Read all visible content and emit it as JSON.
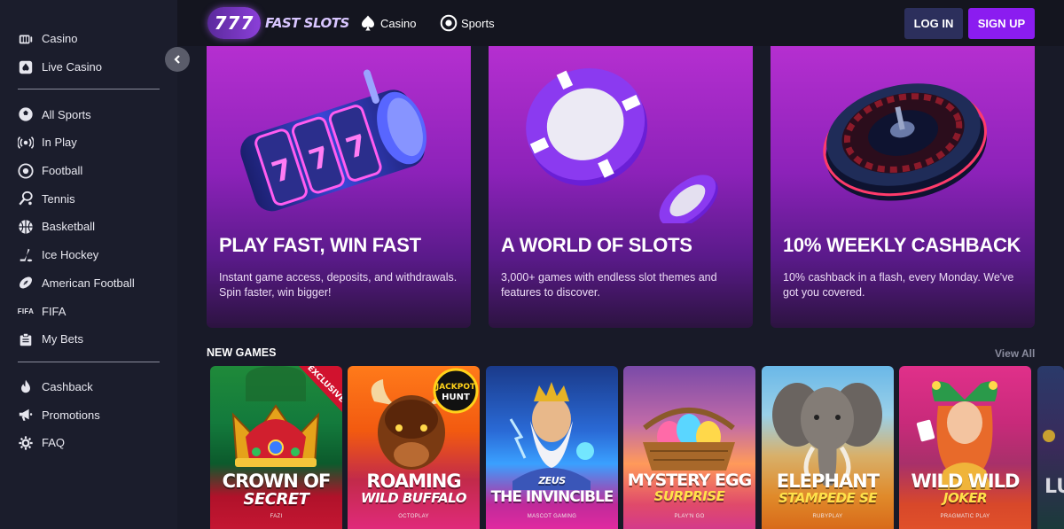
{
  "sidebar": {
    "groups": [
      [
        {
          "label": "Casino",
          "icon": "casino-icon"
        },
        {
          "label": "Live Casino",
          "icon": "live-casino-icon"
        }
      ],
      [
        {
          "label": "All Sports",
          "icon": "all-sports-icon"
        },
        {
          "label": "In Play",
          "icon": "in-play-icon"
        },
        {
          "label": "Football",
          "icon": "football-icon"
        },
        {
          "label": "Tennis",
          "icon": "tennis-icon"
        },
        {
          "label": "Basketball",
          "icon": "basketball-icon"
        },
        {
          "label": "Ice Hockey",
          "icon": "ice-hockey-icon"
        },
        {
          "label": "American Football",
          "icon": "american-football-icon"
        },
        {
          "label": "FIFA",
          "icon": "fifa-icon"
        },
        {
          "label": "My Bets",
          "icon": "my-bets-icon"
        }
      ],
      [
        {
          "label": "Cashback",
          "icon": "cashback-icon"
        },
        {
          "label": "Promotions",
          "icon": "promotions-icon"
        },
        {
          "label": "FAQ",
          "icon": "faq-icon"
        }
      ]
    ],
    "fifa_badge": "FIFA"
  },
  "header": {
    "logo_number": "777",
    "logo_text": "FAST SLOTS",
    "nav": [
      {
        "label": "Casino",
        "icon": "spade-icon"
      },
      {
        "label": "Sports",
        "icon": "soccer-ball-icon"
      }
    ],
    "login_label": "LOG IN",
    "signup_label": "SIGN UP"
  },
  "promos": [
    {
      "title": "PLAY FAST, WIN FAST",
      "text": "Instant game access, deposits, and withdrawals. Spin faster, win bigger!",
      "art": "slot-reel"
    },
    {
      "title": "A WORLD OF SLOTS",
      "text": "3,000+ games with endless slot themes and features to discover.",
      "art": "casino-chips"
    },
    {
      "title": "10% WEEKLY CASHBACK",
      "text": "10% cashback in a flash, every Monday. We've got you covered.",
      "art": "roulette-wheel"
    }
  ],
  "new_games": {
    "title": "NEW GAMES",
    "view_all": "View All",
    "games": [
      {
        "line1": "CROWN OF",
        "line2": "SECRET",
        "provider": "FAZI",
        "badge": "EXCLUSIVE"
      },
      {
        "line1": "ROAMING",
        "line2": "WILD BUFFALO",
        "provider": "OCTOPLAY",
        "badge": "JACKPOT HUNT"
      },
      {
        "line1": "ZEUS",
        "line2": "THE INVINCIBLE",
        "provider": "MASCOT GAMING"
      },
      {
        "line1": "MYSTERY EGG",
        "line2": "SURPRISE",
        "provider": "PLAY'N GO"
      },
      {
        "line1": "ELEPHANT",
        "line2": "STAMPEDE SE",
        "provider": "RUBYPLAY"
      },
      {
        "line1": "WILD WILD",
        "line2": "JOKER",
        "provider": "PRAGMATIC PLAY"
      }
    ],
    "partial_tile_text": "LU"
  },
  "colors": {
    "background": "#181a28",
    "sidebar": "#1b1d2c",
    "topbar": "#14151f",
    "login": "#2c2f5c",
    "signup": "#8b1cf0",
    "promo_top": "#b52fd0",
    "promo_bottom": "#2c1340"
  }
}
